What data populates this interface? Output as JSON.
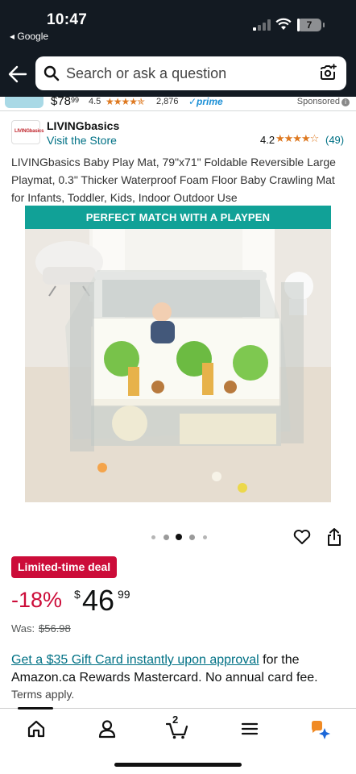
{
  "status_bar": {
    "time": "10:47",
    "back_label": "◂ Google",
    "battery": "7"
  },
  "search": {
    "placeholder": "Search or ask a question"
  },
  "sponsored_strip": {
    "price": "$78",
    "price_fraction": "99",
    "rating": "4.5",
    "stars": "★★★★✯",
    "review_count": "2,876",
    "prime": "✓prime",
    "sponsored_label": "Sponsored",
    "info": "i"
  },
  "brand": {
    "logo_text": "LIVINGbasics",
    "name": "LIVINGbasics",
    "visit_store": "Visit the Store",
    "rating": "4.2",
    "stars": "★★★★☆",
    "review_count": "(49)"
  },
  "product": {
    "title": "LIVINGbasics Baby Play Mat, 79\"x71\" Foldable Reversible Large Playmat, 0.3\" Thicker Waterproof Foam Floor Baby Crawling Mat for Infants, Toddler, Kids, Indoor Outdoor Use",
    "image_banner": "PERFECT MATCH WITH A PLAYPEN"
  },
  "carousel": {
    "total": 5,
    "active_index": 2
  },
  "deal": {
    "badge": "Limited-time deal",
    "discount": "-18%",
    "price_symbol": "$",
    "price_whole": "46",
    "price_fraction": "99",
    "was_label": "Was:",
    "was_price": "$56.98"
  },
  "offer": {
    "link_text": "Get a $35 Gift Card instantly upon approval",
    "tail": " for the",
    "line2": "Amazon.ca Rewards Mastercard. No annual card fee.",
    "terms": "Terms apply."
  },
  "bottom_nav": {
    "cart_count": "2",
    "items": [
      "home-icon",
      "account-icon",
      "cart-icon",
      "menu-icon",
      "rufus-icon"
    ]
  },
  "colors": {
    "header_bg": "#131a22",
    "link": "#007185",
    "deal_red": "#cc0c39",
    "star": "#de7921",
    "banner_teal": "#11a197"
  }
}
